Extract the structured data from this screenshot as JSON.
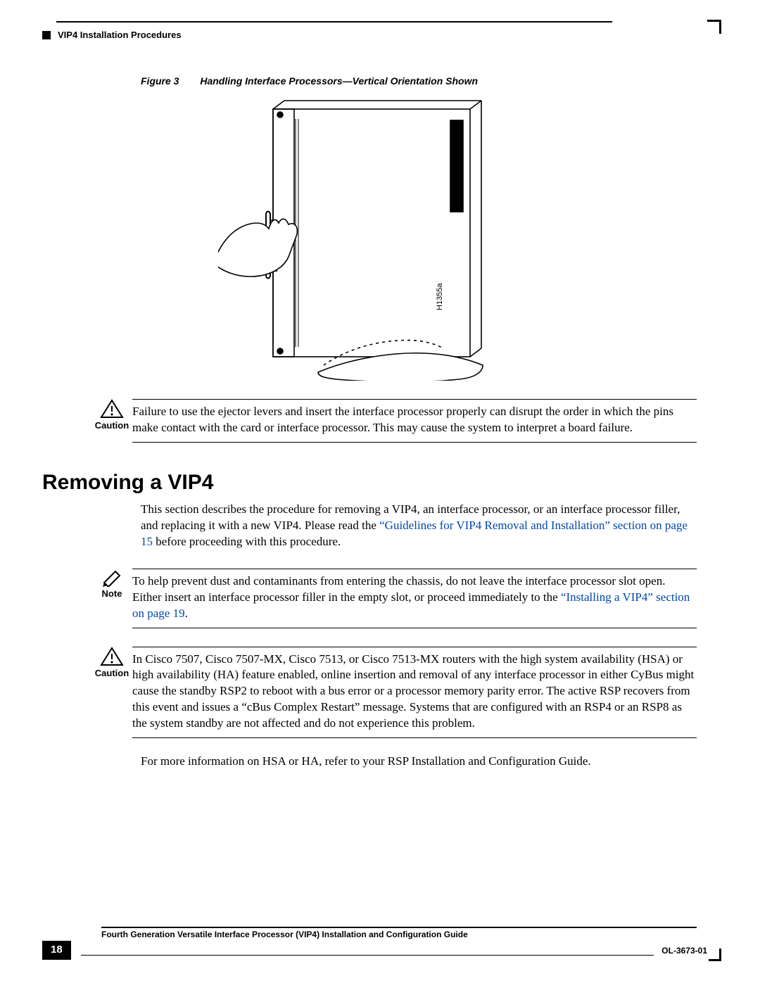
{
  "header": {
    "running": "VIP4 Installation Procedures"
  },
  "figure": {
    "label": "Figure 3",
    "caption": "Handling Interface Processors—Vertical Orientation Shown",
    "tag": "H1355a"
  },
  "caution1": {
    "label": "Caution",
    "text": "Failure to use the ejector levers and insert the interface processor properly can disrupt the order in which the pins make contact with the card or interface processor. This may cause the system to interpret a board failure."
  },
  "section": {
    "title": "Removing a VIP4"
  },
  "intro": {
    "pre": "This section describes the procedure for removing a VIP4, an interface processor, or an interface processor filler, and replacing it with a new VIP4. Please read the ",
    "link": "“Guidelines for VIP4 Removal and Installation” section on page 15",
    "post": " before proceeding with this procedure."
  },
  "note": {
    "label": "Note",
    "pre": "To help prevent dust and contaminants from entering the chassis, do not leave the interface processor slot open. Either insert an interface processor filler in the empty slot, or proceed immediately to the ",
    "link": "“Installing a VIP4” section on page 19",
    "post": "."
  },
  "caution2": {
    "label": "Caution",
    "text": "In Cisco 7507, Cisco 7507-MX, Cisco 7513, or Cisco 7513-MX routers with the high system availability (HSA) or high availability (HA) feature enabled, online insertion and removal of any interface processor in either CyBus might cause the standby RSP2 to reboot with a bus error or a processor memory parity error. The active RSP recovers from this event and issues a “cBus Complex Restart” message. Systems that are configured with an RSP4 or an RSP8 as the system standby are not affected and do not experience this problem."
  },
  "moreinfo": "For more information on HSA or HA, refer to your RSP Installation and Configuration Guide.",
  "footer": {
    "title": "Fourth Generation Versatile Interface Processor (VIP4) Installation and Configuration Guide",
    "page": "18",
    "docnum": "OL-3673-01"
  }
}
